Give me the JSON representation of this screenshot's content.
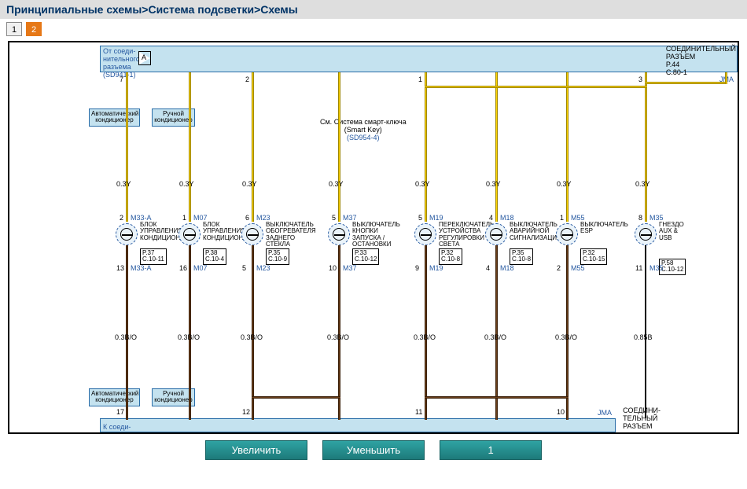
{
  "breadcrumb": "Принципиальные схемы>Система подсветки>Схемы",
  "tabs": {
    "t1": "1",
    "t2": "2"
  },
  "bus_top": {
    "src_line1": "От соеди-",
    "src_line2": "нительного",
    "src_line3": "разъема",
    "src_ref": "(SD941-1)",
    "amp": "A"
  },
  "conn_top": {
    "l1": "СОЕДИНИТЕЛЬНЫЙ",
    "l2": "РАЗЪЕМ",
    "l3": "P.44",
    "l4": "C.80-1"
  },
  "conn_bot": {
    "l1": "СОЕДИНИ-",
    "l2": "ТЕЛЬНЫЙ",
    "l3": "РАЗЪЕМ"
  },
  "bus_bot": {
    "l1": "К соеди-"
  },
  "jma": "JMA",
  "smart": {
    "l1": "См. Система смарт-ключа",
    "l2": "(Smart Key)",
    "ref": "(SD954-4)"
  },
  "auto_ac": "Автоматический\nкондиционер",
  "man_ac": "Ручной\nкондиционер",
  "columns": [
    {
      "pin_t": "7",
      "pin_n": "2",
      "code": "M33-A",
      "ga": "0.3Y",
      "name": "БЛОК\nУПРАВЛЕНИЯ\nКОНДИЦИОНЕРОМ",
      "ref": "P.37\nC.10-11",
      "pin_b": "13",
      "code_b": "M33-A",
      "ga_b": "0.3B/O",
      "pin_bb": "17"
    },
    {
      "pin_t": "",
      "pin_n": "1",
      "code": "M07",
      "ga": "0.3Y",
      "name": "БЛОК\nУПРАВЛЕНИЯ\nКОНДИЦИОНЕРОМ",
      "ref": "P.38\nC.10-4",
      "pin_b": "16",
      "code_b": "M07",
      "ga_b": "0.3B/O",
      "pin_bb": ""
    },
    {
      "pin_t": "2",
      "pin_n": "6",
      "code": "M23",
      "ga": "0.3Y",
      "name": "ВЫКЛЮЧАТЕЛЬ\nОБОГРЕВАТЕЛЯ\nЗАДНЕГО СТЕКЛА",
      "ref": "P.35\nC.10-9",
      "pin_b": "5",
      "code_b": "M23",
      "ga_b": "0.3B/O",
      "pin_bb": "12"
    },
    {
      "pin_t": "",
      "pin_n": "5",
      "code": "M37",
      "ga": "0.3Y",
      "name": "ВЫКЛЮЧАТЕЛЬ\nКНОПКИ\nЗАПУСКА /\nОСТАНОВКИ",
      "ref": "P.33\nC.10-12",
      "pin_b": "10",
      "code_b": "M37",
      "ga_b": "0.3B/O",
      "pin_bb": ""
    },
    {
      "pin_t": "1",
      "pin_n": "5",
      "code": "M19",
      "ga": "0.3Y",
      "name": "ПЕРЕКЛЮЧАТЕЛЬ\nУСТРОЙСТВА\nРЕГУЛИРОВКИ\nСВЕТА\nФАР",
      "ref": "P.32\nC.10-8",
      "pin_b": "9",
      "code_b": "M19",
      "ga_b": "0.3B/O",
      "pin_bb": "11"
    },
    {
      "pin_t": "",
      "pin_n": "4",
      "code": "M18",
      "ga": "0.3Y",
      "name": "ВЫКЛЮЧАТЕЛЬ\nАВАРИЙНОЙ\nСИГНАЛИЗАЦИИ",
      "ref": "P.35\nC.10-8",
      "pin_b": "4",
      "code_b": "M18",
      "ga_b": "0.3B/O",
      "pin_bb": ""
    },
    {
      "pin_t": "",
      "pin_n": "1",
      "code": "M55",
      "ga": "0.3Y",
      "name": "ВЫКЛЮЧАТЕЛЬ\nESP",
      "ref": "P.32\nC.10-15",
      "pin_b": "2",
      "code_b": "M55",
      "ga_b": "0.3B/O",
      "pin_bb": "10"
    },
    {
      "pin_t": "3",
      "pin_n": "8",
      "code": "M35",
      "ga": "0.3Y",
      "name": "ГНЕЗДО\nAUX &\nUSB",
      "ref": "",
      "pin_b": "11",
      "code_b": "M35",
      "ga_b": "0.85B",
      "pin_bb": "",
      "ref2": "P.58\nC.10-12"
    }
  ],
  "buttons": {
    "zoom_in": "Увеличить",
    "zoom_out": "Уменьшить",
    "page": "1"
  }
}
